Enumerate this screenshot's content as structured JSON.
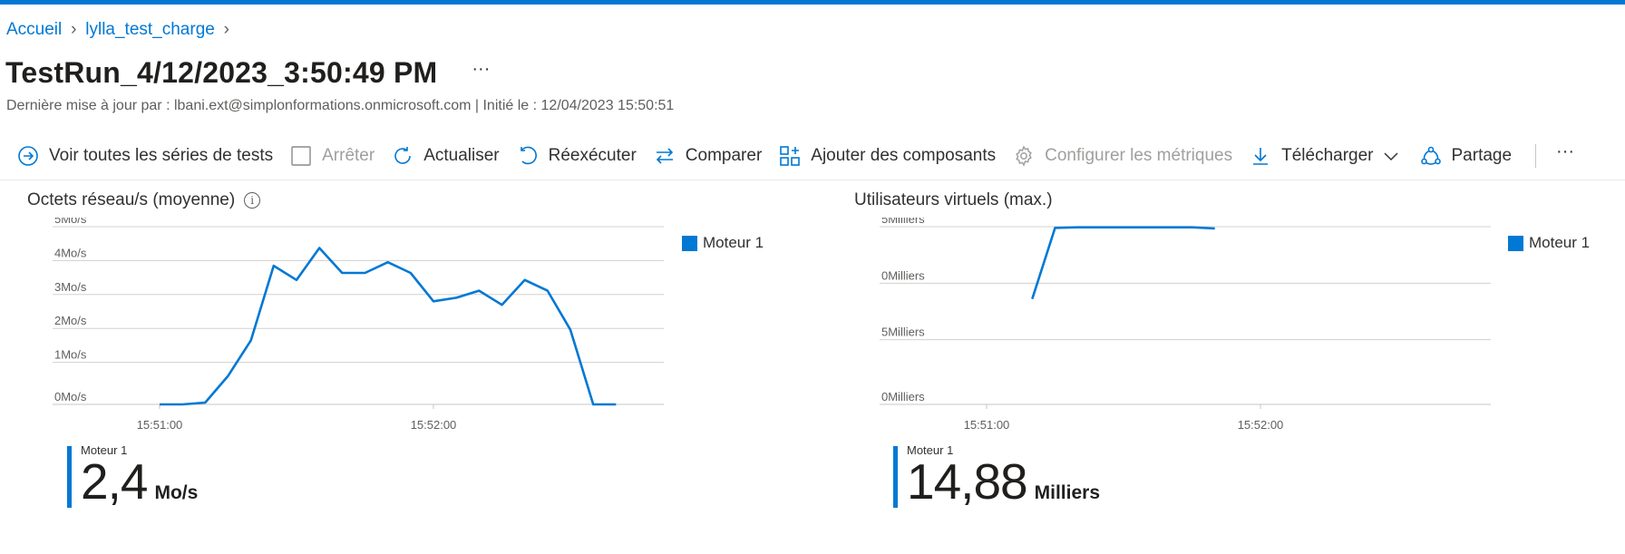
{
  "colors": {
    "accent": "#0078d4",
    "series": "#0078d4",
    "grid": "#c8c6c4",
    "disabled": "#a19f9d"
  },
  "breadcrumb": {
    "items": [
      "Accueil",
      "lylla_test_charge"
    ]
  },
  "header": {
    "title": "TestRun_4/12/2023_3:50:49 PM",
    "more": "···",
    "subtitle": "Dernière mise à jour par : lbani.ext@simplonformations.onmicrosoft.com | Initié le : 12/04/2023 15:50:51"
  },
  "toolbar": {
    "items": [
      {
        "label": "Voir toutes les séries de tests",
        "icon": "arrow-circle-icon",
        "disabled": false
      },
      {
        "label": "Arrêter",
        "icon": "checkbox-icon",
        "disabled": true
      },
      {
        "label": "Actualiser",
        "icon": "refresh-icon",
        "disabled": false
      },
      {
        "label": "Réexécuter",
        "icon": "rerun-icon",
        "disabled": false
      },
      {
        "label": "Comparer",
        "icon": "compare-icon",
        "disabled": false
      },
      {
        "label": "Ajouter des composants",
        "icon": "add-components-icon",
        "disabled": false
      },
      {
        "label": "Configurer les métriques",
        "icon": "gear-icon",
        "disabled": true
      },
      {
        "label": "Télécharger",
        "icon": "download-icon",
        "disabled": false
      },
      {
        "label": "Partage",
        "icon": "share-icon",
        "disabled": false
      }
    ],
    "more": "···"
  },
  "panels": [
    {
      "title": "Octets réseau/s (moyenne)",
      "legend": "Moteur 1",
      "kpi": {
        "label": "Moteur 1",
        "value": "2,4",
        "unit": "Mo/s"
      }
    },
    {
      "title": "Utilisateurs virtuels (max.)",
      "legend": "Moteur 1",
      "kpi": {
        "label": "Moteur 1",
        "value": "14,88",
        "unit": "Milliers"
      }
    }
  ],
  "chart_data": [
    {
      "type": "line",
      "title": "Octets réseau/s (moyenne)",
      "ylabel": "",
      "xlabel": "",
      "y_ticks": [
        "0Mo/s",
        "1Mo/s",
        "2Mo/s",
        "3Mo/s",
        "4Mo/s",
        "5Mo/s"
      ],
      "x_ticks": [
        "15:51:00",
        "15:52:00"
      ],
      "ylim": [
        0,
        5
      ],
      "grid": true,
      "legend_position": "right",
      "series": [
        {
          "name": "Moteur 1",
          "x": [
            "15:51:00",
            "15:51:05",
            "15:51:10",
            "15:51:15",
            "15:51:20",
            "15:51:25",
            "15:51:30",
            "15:51:35",
            "15:51:40",
            "15:51:45",
            "15:51:50",
            "15:51:55",
            "15:52:00",
            "15:52:05",
            "15:52:10",
            "15:52:15",
            "15:52:20",
            "15:52:25",
            "15:52:30",
            "15:52:35",
            "15:52:40"
          ],
          "values": [
            0,
            0,
            0.05,
            0.8,
            1.8,
            3.9,
            3.5,
            4.4,
            3.7,
            3.7,
            4.0,
            3.7,
            2.9,
            3.0,
            3.2,
            2.8,
            3.5,
            3.2,
            2.1,
            0,
            0
          ]
        }
      ]
    },
    {
      "type": "line",
      "title": "Utilisateurs virtuels (max.)",
      "ylabel": "",
      "xlabel": "",
      "y_ticks": [
        "0Milliers",
        "5Milliers",
        "0Milliers",
        "5Milliers"
      ],
      "x_ticks": [
        "15:51:00",
        "15:52:00"
      ],
      "ylim": [
        0,
        15
      ],
      "grid": true,
      "legend_position": "right",
      "series": [
        {
          "name": "Moteur 1",
          "x": [
            "15:51:10",
            "15:51:15",
            "15:51:20",
            "15:51:30",
            "15:51:40",
            "15:51:45",
            "15:51:50"
          ],
          "values": [
            8.9,
            14.9,
            14.95,
            14.95,
            14.95,
            14.95,
            14.85
          ]
        }
      ]
    }
  ]
}
